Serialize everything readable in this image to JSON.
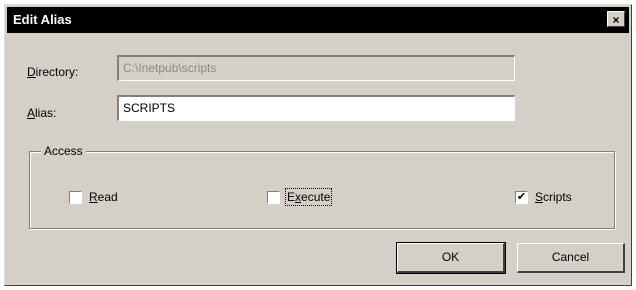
{
  "window": {
    "title": "Edit Alias",
    "close_glyph": "×"
  },
  "directory": {
    "label_access": "D",
    "label_rest": "irectory:",
    "value": "C:\\Inetpub\\scripts"
  },
  "alias": {
    "label_access": "A",
    "label_rest": "lias:",
    "value": "SCRIPTS"
  },
  "access": {
    "legend": "Access",
    "read": {
      "access": "R",
      "rest": "ead",
      "checked": false
    },
    "execute": {
      "prefix": "E",
      "access": "x",
      "rest": "ecute",
      "checked": false
    },
    "scripts": {
      "access": "S",
      "rest": "cripts",
      "checked": true
    }
  },
  "buttons": {
    "ok": "OK",
    "cancel": "Cancel"
  },
  "check_glyph": "✔",
  "icons": {
    "close": "close-icon",
    "check": "check-icon"
  }
}
